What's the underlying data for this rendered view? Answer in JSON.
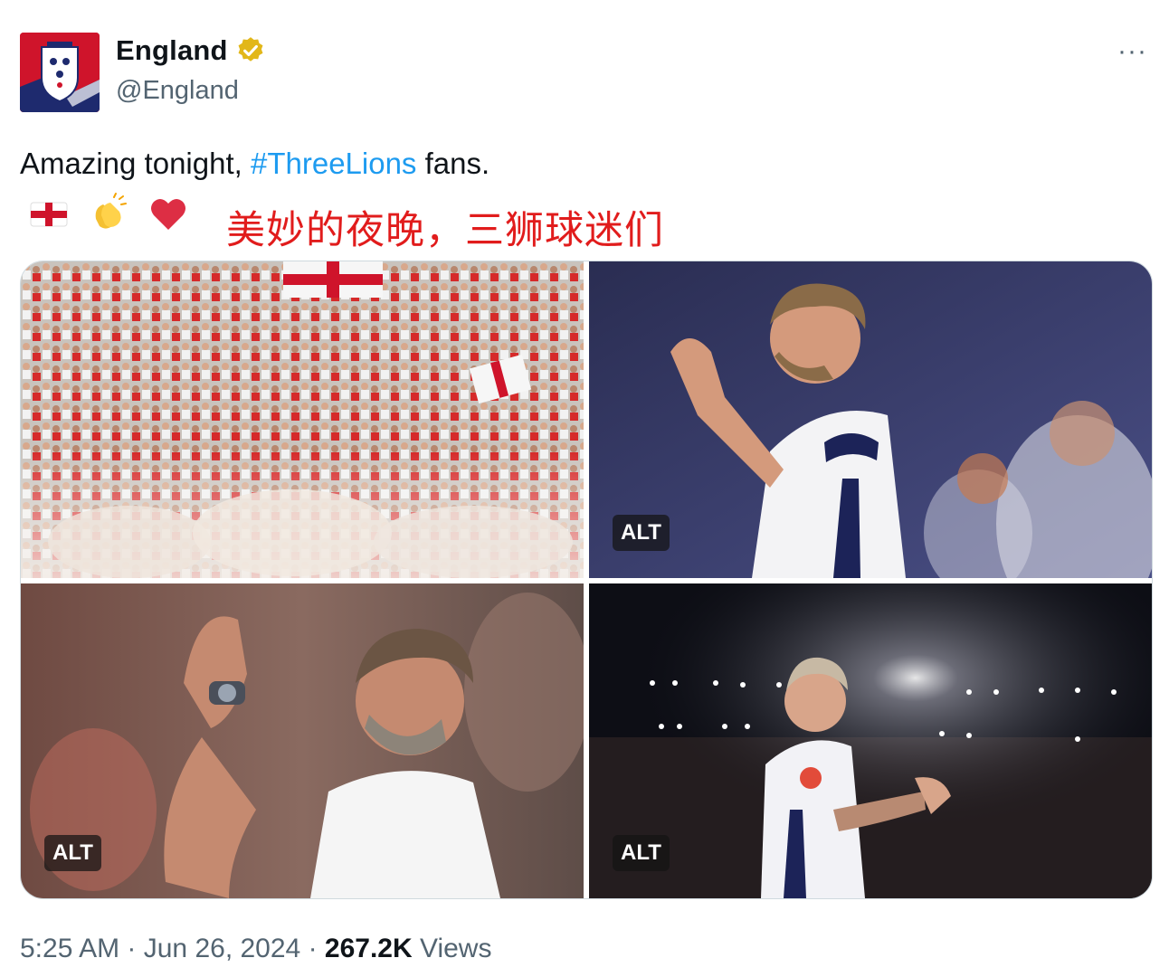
{
  "author": {
    "display_name": "England",
    "handle": "@England"
  },
  "more_label": "···",
  "tweet": {
    "text_before": "Amazing tonight, ",
    "hashtag": "#ThreeLions",
    "text_after": " fans.",
    "emojis": [
      "england-flag-icon",
      "clapping-hands-icon",
      "red-heart-icon"
    ],
    "translation": "美妙的夜晚，三狮球迷们"
  },
  "media": {
    "alt_label": "ALT",
    "images": [
      {
        "name": "fans-crowd-photo",
        "has_alt": false
      },
      {
        "name": "player-applauding-photo",
        "has_alt": true
      },
      {
        "name": "manager-applauding-photo",
        "has_alt": true
      },
      {
        "name": "player-night-stadium-photo",
        "has_alt": true
      }
    ]
  },
  "meta": {
    "time": "5:25 AM",
    "separator": " · ",
    "date": "Jun 26, 2024",
    "views_count": "267.2K",
    "views_label": " Views"
  },
  "colors": {
    "accent": "#1d9bf0",
    "translation": "#e11c1c",
    "muted": "#536471",
    "verified_gold": "#e2b719"
  }
}
